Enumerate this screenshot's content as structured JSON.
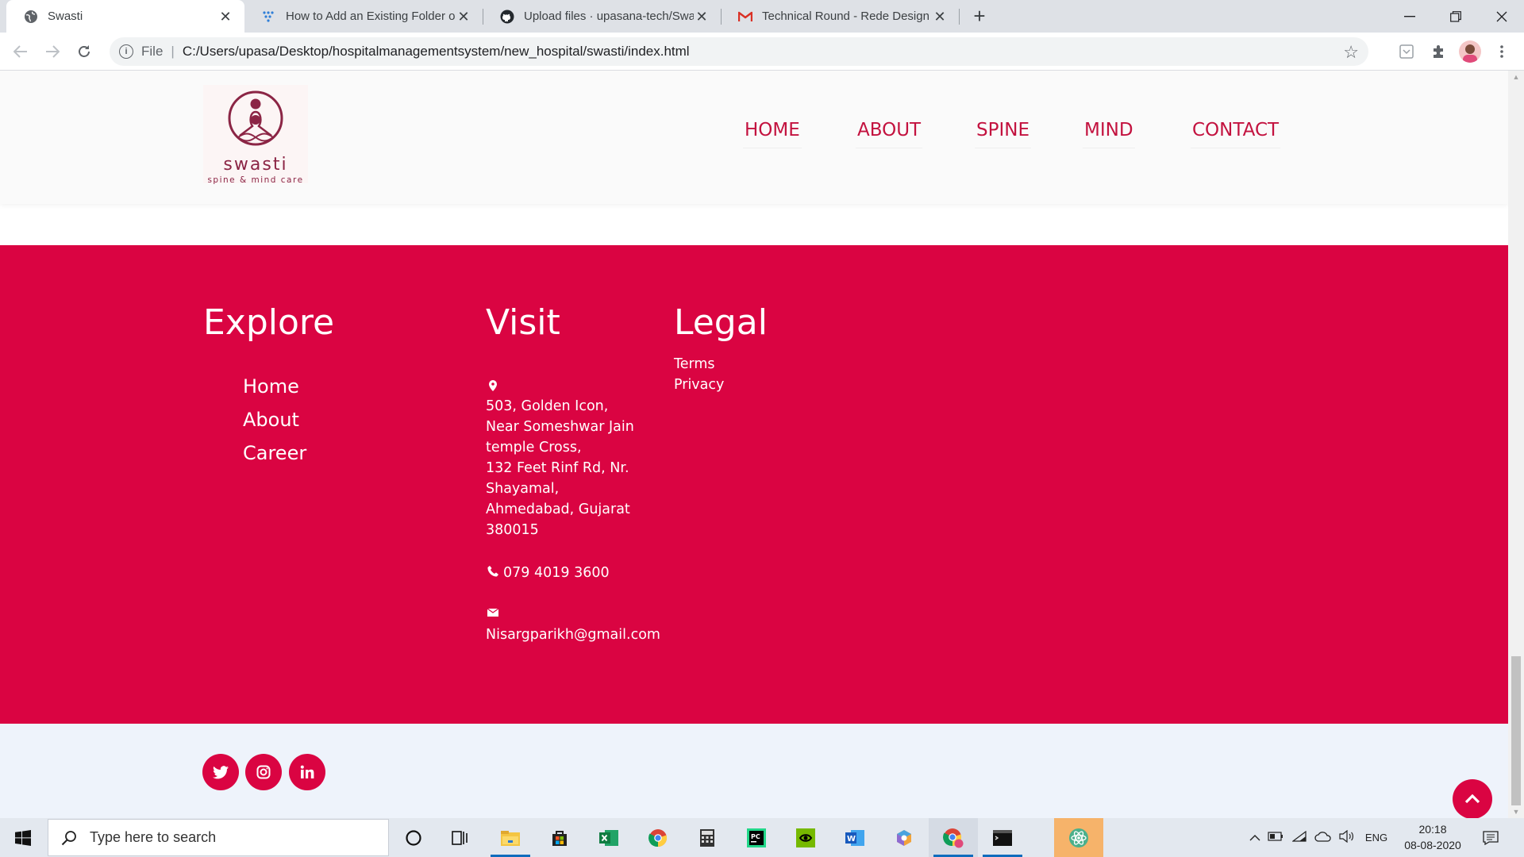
{
  "browser": {
    "tabs": [
      {
        "title": "Swasti",
        "active": true
      },
      {
        "title": "How to Add an Existing Folder or",
        "active": false
      },
      {
        "title": "Upload files · upasana-tech/Swas",
        "active": false
      },
      {
        "title": "Technical Round - Rede Design S",
        "active": false
      }
    ],
    "url_scheme": "File",
    "url": "C:/Users/upasa/Desktop/hospitalmanagementsystem/new_hospital/swasti/index.html"
  },
  "site": {
    "logo_word": "swasti",
    "logo_tagline": "spine & mind care",
    "nav": [
      "HOME",
      "ABOUT",
      "SPINE",
      "MIND",
      "CONTACT"
    ],
    "footer": {
      "explore_heading": "Explore",
      "explore_links": [
        "Home",
        "About",
        "Career"
      ],
      "visit_heading": "Visit",
      "address_lines": [
        "503, Golden Icon,",
        "Near Someshwar Jain",
        "temple Cross,",
        "132 Feet Rinf Rd, Nr.",
        "Shayamal,",
        "Ahmedabad, Gujarat",
        "380015"
      ],
      "phone": "079 4019 3600",
      "email": "Nisargparikh@gmail.com",
      "legal_heading": "Legal",
      "legal_links": [
        "Terms",
        "Privacy"
      ]
    },
    "social": [
      "twitter-icon",
      "instagram-icon",
      "linkedin-icon"
    ],
    "brand_color": "#da0442",
    "nav_color": "#c3123f"
  },
  "taskbar": {
    "search_placeholder": "Type here to search",
    "language": "ENG",
    "time": "20:18",
    "date": "08-08-2020"
  }
}
